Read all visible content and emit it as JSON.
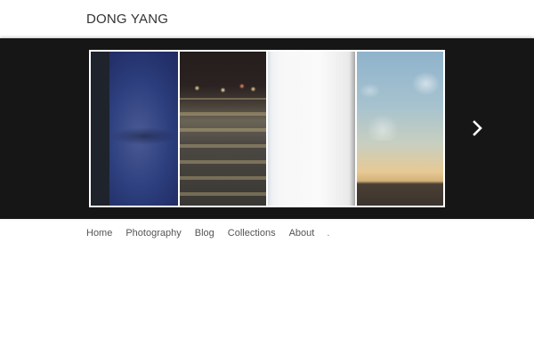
{
  "site": {
    "title": "DONG YANG"
  },
  "slider": {
    "slides": [
      {
        "name": "blurred-blue-photo"
      },
      {
        "name": "night-crosswalk-photo"
      },
      {
        "name": "white-wall-photo"
      },
      {
        "name": "sunset-sky-photo"
      }
    ],
    "next_icon": "chevron-right-icon"
  },
  "nav": {
    "items": [
      {
        "label": "Home"
      },
      {
        "label": "Photography"
      },
      {
        "label": "Blog"
      },
      {
        "label": "Collections"
      },
      {
        "label": "About"
      },
      {
        "label": "."
      }
    ]
  },
  "colors": {
    "slider_background": "#161616",
    "page_background": "#ffffff",
    "nav_text": "#555555",
    "title_text": "#333333"
  }
}
